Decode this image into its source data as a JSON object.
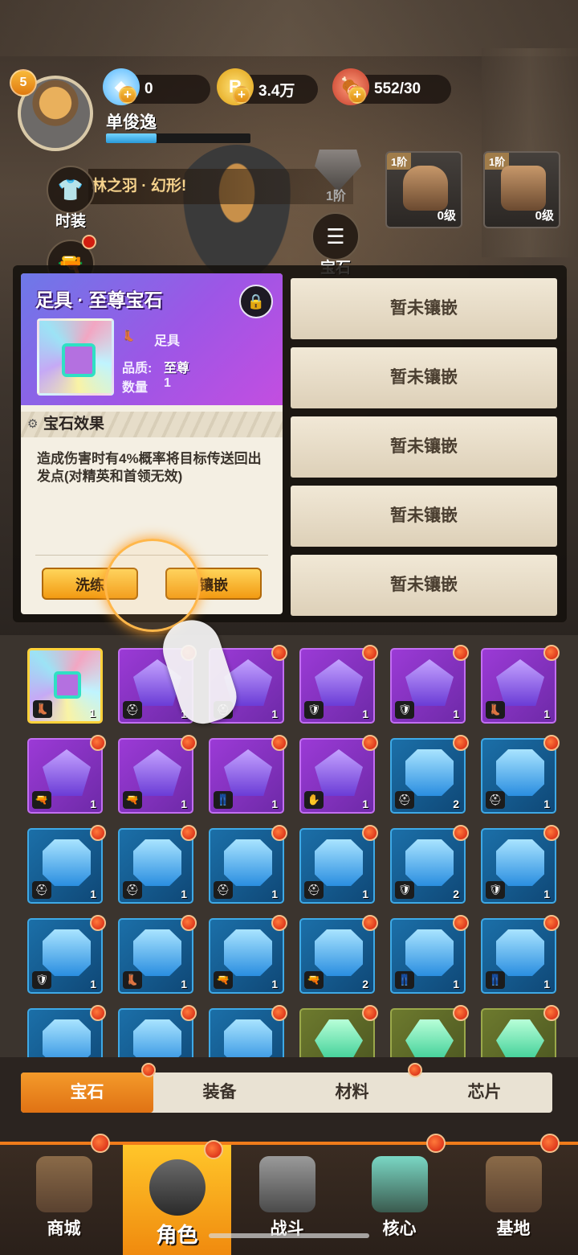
{
  "player": {
    "level": "5",
    "name": "单俊逸",
    "xp_fraction": 0.35
  },
  "resources": [
    {
      "icon": "diamond-icon",
      "value": "0"
    },
    {
      "icon": "gold-coin-icon",
      "value": "3.4万"
    },
    {
      "icon": "meat-stamina-icon",
      "value": "552/30"
    }
  ],
  "side_buttons": {
    "fashion": "时装",
    "gem": "宝石"
  },
  "banner_text": "林之羽 · 幻形!",
  "equip_slots": [
    {
      "tier": "1阶",
      "level": "0级"
    },
    {
      "tier": "1阶",
      "level": "0级"
    }
  ],
  "ghost_tier": "1阶",
  "gem_card": {
    "title": "足具 · 至尊宝石",
    "part": "足具",
    "quality_label": "品质:",
    "quality_value": "至尊",
    "quantity_label": "数量",
    "quantity_value": "1",
    "effect_title": "宝石效果",
    "effect_desc": "造成伤害时有4%概率将目标传送回出发点(对精英和首领无效)",
    "refine_button": "洗练",
    "inlay_button": "镶嵌"
  },
  "inlay_slots": [
    "暂未镶嵌",
    "暂未镶嵌",
    "暂未镶嵌",
    "暂未镶嵌",
    "暂未镶嵌"
  ],
  "inventory": [
    {
      "type": "supreme",
      "count": "1",
      "part": "boot-icon",
      "dot": false
    },
    {
      "type": "purple",
      "count": "1",
      "part": "helmet-icon",
      "dot": true
    },
    {
      "type": "purple",
      "count": "1",
      "part": "helmet-icon",
      "dot": true
    },
    {
      "type": "purple",
      "count": "1",
      "part": "armor-icon",
      "dot": true
    },
    {
      "type": "purple",
      "count": "1",
      "part": "armor-icon",
      "dot": true
    },
    {
      "type": "purple",
      "count": "1",
      "part": "boot-icon",
      "dot": true
    },
    {
      "type": "purple",
      "count": "1",
      "part": "weapon-icon",
      "dot": true
    },
    {
      "type": "purple",
      "count": "1",
      "part": "weapon-icon",
      "dot": true
    },
    {
      "type": "purple",
      "count": "1",
      "part": "pants-icon",
      "dot": true
    },
    {
      "type": "purple",
      "count": "1",
      "part": "glove-icon",
      "dot": true
    },
    {
      "type": "blue",
      "count": "2",
      "part": "helmet-icon",
      "dot": true
    },
    {
      "type": "blue",
      "count": "1",
      "part": "helmet-icon",
      "dot": true
    },
    {
      "type": "blue",
      "count": "1",
      "part": "helmet-icon",
      "dot": true
    },
    {
      "type": "blue",
      "count": "1",
      "part": "helmet-icon",
      "dot": true
    },
    {
      "type": "blue",
      "count": "1",
      "part": "helmet-icon",
      "dot": true
    },
    {
      "type": "blue",
      "count": "1",
      "part": "helmet-icon",
      "dot": true
    },
    {
      "type": "blue",
      "count": "2",
      "part": "armor-icon",
      "dot": true
    },
    {
      "type": "blue",
      "count": "1",
      "part": "armor-icon",
      "dot": true
    },
    {
      "type": "blue",
      "count": "1",
      "part": "armor-icon",
      "dot": true
    },
    {
      "type": "blue",
      "count": "1",
      "part": "boot-icon",
      "dot": true
    },
    {
      "type": "blue",
      "count": "1",
      "part": "weapon-icon",
      "dot": true
    },
    {
      "type": "blue",
      "count": "2",
      "part": "weapon-icon",
      "dot": true
    },
    {
      "type": "blue",
      "count": "1",
      "part": "pants-icon",
      "dot": true
    },
    {
      "type": "blue",
      "count": "1",
      "part": "pants-icon",
      "dot": true
    },
    {
      "type": "blue",
      "count": "",
      "part": "",
      "dot": true
    },
    {
      "type": "blue",
      "count": "",
      "part": "",
      "dot": true
    },
    {
      "type": "blue",
      "count": "",
      "part": "",
      "dot": true
    },
    {
      "type": "green",
      "count": "",
      "part": "",
      "dot": true
    },
    {
      "type": "green",
      "count": "",
      "part": "",
      "dot": true
    },
    {
      "type": "green",
      "count": "",
      "part": "",
      "dot": true
    }
  ],
  "category_tabs": [
    "宝石",
    "装备",
    "材料",
    "芯片"
  ],
  "bottom_nav": [
    "商城",
    "角色",
    "战斗",
    "核心",
    "基地"
  ],
  "colors": {
    "accent": "#f07c1a",
    "purple_quality": "#9b3ad6",
    "blue_quality": "#1b6fa8",
    "notification": "#d11d10"
  }
}
